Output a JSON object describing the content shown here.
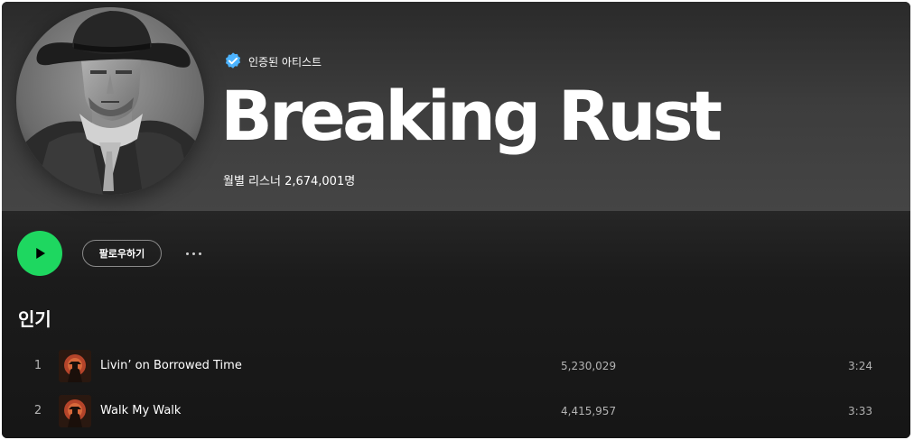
{
  "artist": {
    "verified_label": "인증된 아티스트",
    "name": "Breaking Rust",
    "monthly_listeners": "월별 리스너 2,674,001명"
  },
  "actions": {
    "follow_label": "팔로우하기",
    "play_icon": "play-icon",
    "more_icon": "more-options-icon"
  },
  "popular": {
    "title": "인기",
    "tracks": [
      {
        "number": "1",
        "title": "Livin’ on Borrowed Time",
        "plays": "5,230,029",
        "duration": "3:24"
      },
      {
        "number": "2",
        "title": "Walk My Walk",
        "plays": "4,415,957",
        "duration": "3:33"
      }
    ]
  },
  "colors": {
    "accent_green": "#1ed760",
    "verified_blue": "#4cb3ff",
    "background": "#121212",
    "secondary_text": "#b3b3b3"
  }
}
